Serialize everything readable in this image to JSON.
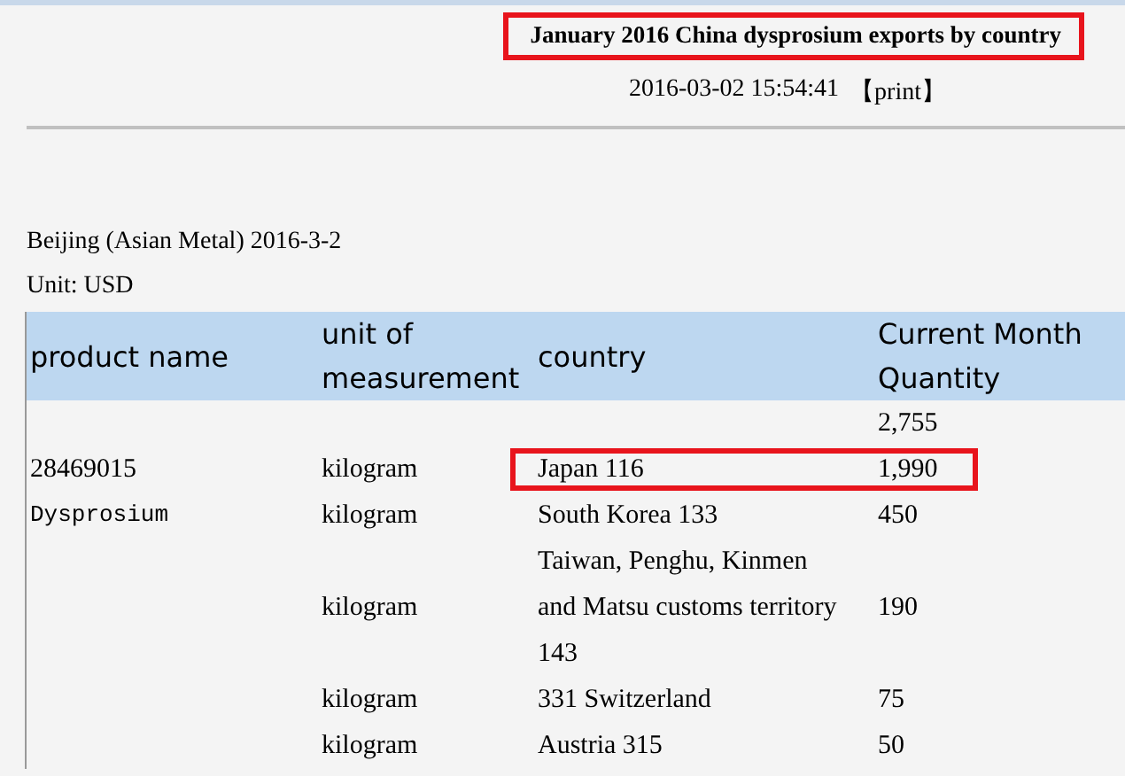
{
  "title": {
    "text": "January 2016 China dysprosium exports by country",
    "highlighted": true
  },
  "date": "2016-03-02 15:54:41",
  "print_link": "【print】",
  "source": "Beijing (Asian Metal) 2016-3-2",
  "unit": "Unit: USD",
  "table": {
    "columns": [
      "product name",
      "unit of measurement",
      "country",
      "Current Month Quantity"
    ],
    "rows": [
      {
        "cells": [
          "",
          "",
          "",
          "2,755"
        ],
        "highlighted": false
      },
      {
        "cells": [
          "28469015",
          "kilogram",
          "Japan 116",
          "1,990"
        ],
        "highlighted": true
      },
      {
        "cells": [
          "Dysprosium",
          "kilogram",
          "South Korea 133",
          "450"
        ],
        "highlighted": false
      },
      {
        "cells": [
          "",
          "kilogram",
          "Taiwan, Penghu, Kinmen and Matsu customs territory 143",
          "190"
        ],
        "highlighted": false
      },
      {
        "cells": [
          "",
          "kilogram",
          "331 Switzerland",
          "75"
        ],
        "highlighted": false
      },
      {
        "cells": [
          "",
          "kilogram",
          "Austria 315",
          "50"
        ],
        "highlighted": false
      }
    ]
  }
}
